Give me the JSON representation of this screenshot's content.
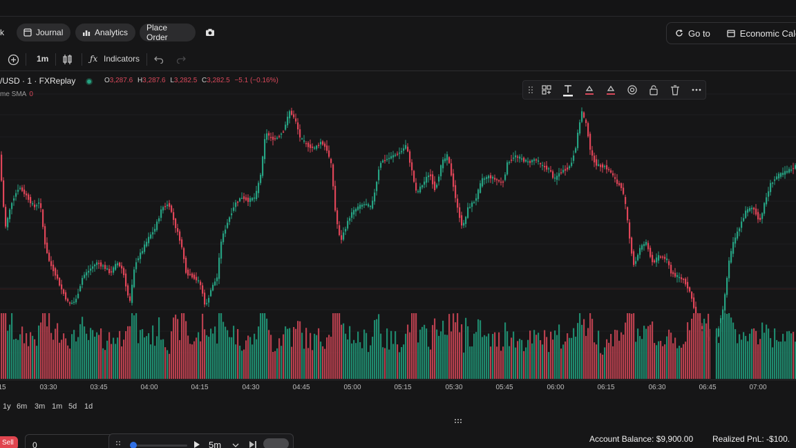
{
  "toolbar": {
    "left_fragment": "k",
    "journal": "Journal",
    "analytics": "Analytics",
    "place_order": "Place Order",
    "go_to": "Go to",
    "economic_calendar": "Economic Cale"
  },
  "chart_toolbar": {
    "interval": "1m",
    "indicators": "Indicators"
  },
  "legend": {
    "symbol": "/USD · 1 · FXReplay",
    "o_key": "O",
    "o_val": "3,287.6",
    "h_key": "H",
    "h_val": "3,287.6",
    "l_key": "L",
    "l_val": "3,282.5",
    "c_key": "C",
    "c_val": "3,282.5",
    "change": "−5.1 (−0.16%)",
    "indicator_name": "me SMA",
    "indicator_value": "0"
  },
  "colors": {
    "up": "#26a383",
    "down": "#e04558",
    "up_vol": "#1f8a6e",
    "down_vol": "#b8404e",
    "background": "#161617"
  },
  "time_axis": [
    "15",
    "03:30",
    "03:45",
    "04:00",
    "04:15",
    "04:30",
    "04:45",
    "05:00",
    "05:15",
    "05:30",
    "05:45",
    "06:00",
    "06:15",
    "06:30",
    "06:45",
    "07:00"
  ],
  "ranges": [
    "1y",
    "6m",
    "3m",
    "1m",
    "5d",
    "1d"
  ],
  "bottom": {
    "sell": "Sell",
    "quantity": "0",
    "speed": "5m",
    "account_balance": "Account Balance: $9,900.00",
    "realized_pnl": "Realized PnL: -$100."
  }
}
